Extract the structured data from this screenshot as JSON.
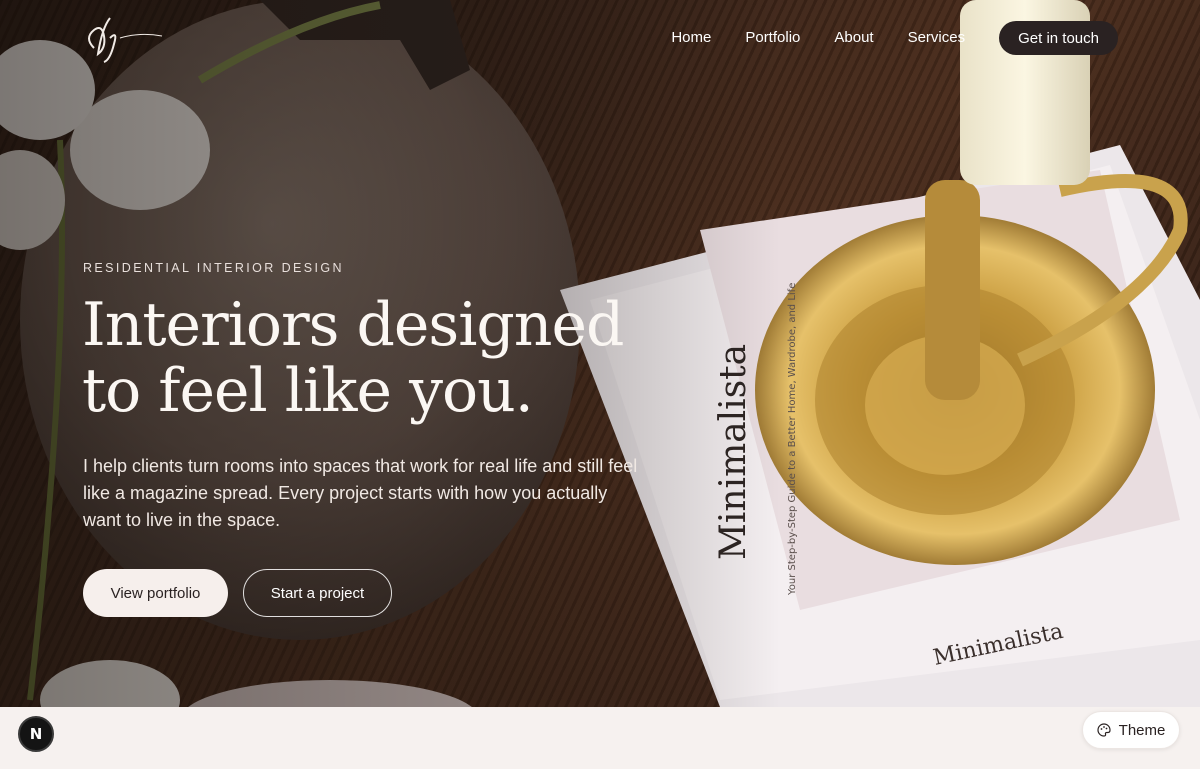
{
  "nav": {
    "items": [
      "Home",
      "Portfolio",
      "About",
      "Services"
    ],
    "cta_label": "Get in touch"
  },
  "hero": {
    "eyebrow": "RESIDENTIAL INTERIOR DESIGN",
    "headline_line1": "Interiors designed",
    "headline_line2": "to feel like you.",
    "lede": "I help clients turn rooms into spaces that work for real life and still feel like a magazine spread. Every project starts with how you actually want to live in the space.",
    "primary_label": "View portfolio",
    "secondary_label": "Start a project"
  },
  "book_text": {
    "spine_title": "Minimalista",
    "cover_title": "Minimalista",
    "subtitle": "Your Step-by-Step Guide to a Better Home, Wardrobe, and Life"
  },
  "footer": {
    "badge_letter": "N",
    "theme_label": "Theme"
  },
  "colors": {
    "accent_dark": "#2a2222",
    "light_bg": "#f6f1ef",
    "wood": "#3b2418",
    "brass": "#c79a3c"
  },
  "icons": {
    "logo": "monogram-logo",
    "theme": "palette-icon"
  }
}
